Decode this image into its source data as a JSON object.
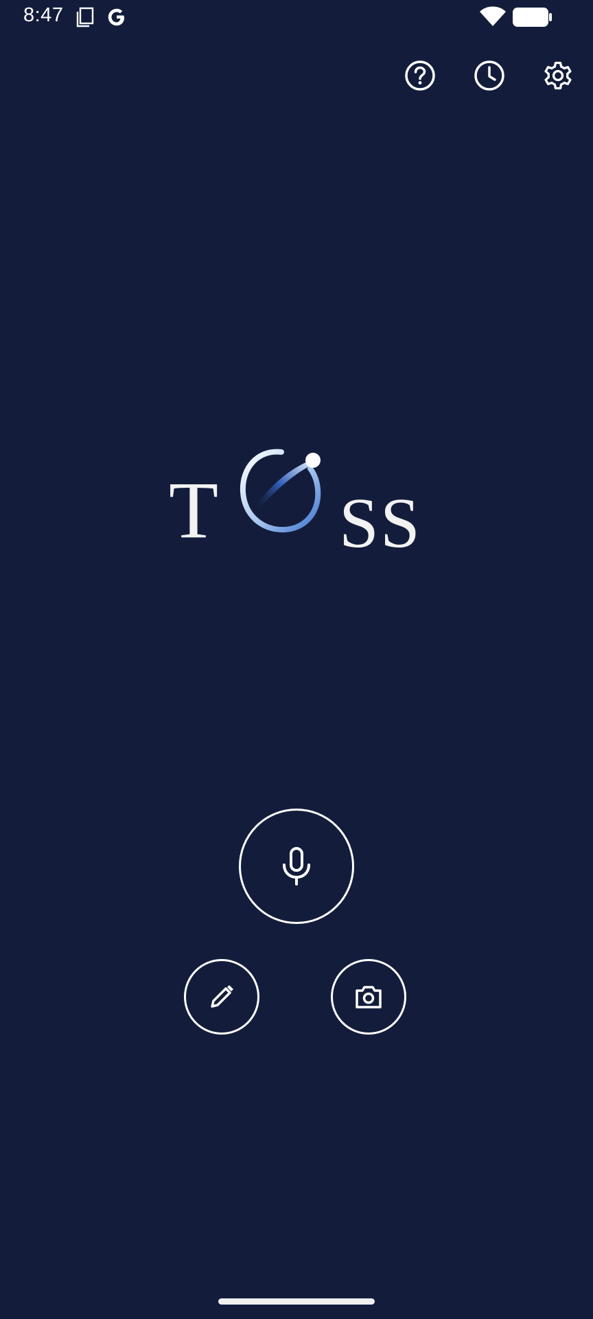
{
  "status_bar": {
    "time": "8:47",
    "icons": [
      "sim-card-icon",
      "google-g-icon",
      "wifi-icon",
      "battery-icon"
    ]
  },
  "toolbar": {
    "icons": [
      "help-icon",
      "history-icon",
      "settings-icon"
    ]
  },
  "logo": {
    "text": "TOSS"
  },
  "actions": {
    "icons": [
      "microphone-icon",
      "pencil-icon",
      "camera-icon"
    ]
  },
  "colors": {
    "background": "#131d3b",
    "foreground": "#ffffff",
    "accent": "#4a80d8"
  }
}
